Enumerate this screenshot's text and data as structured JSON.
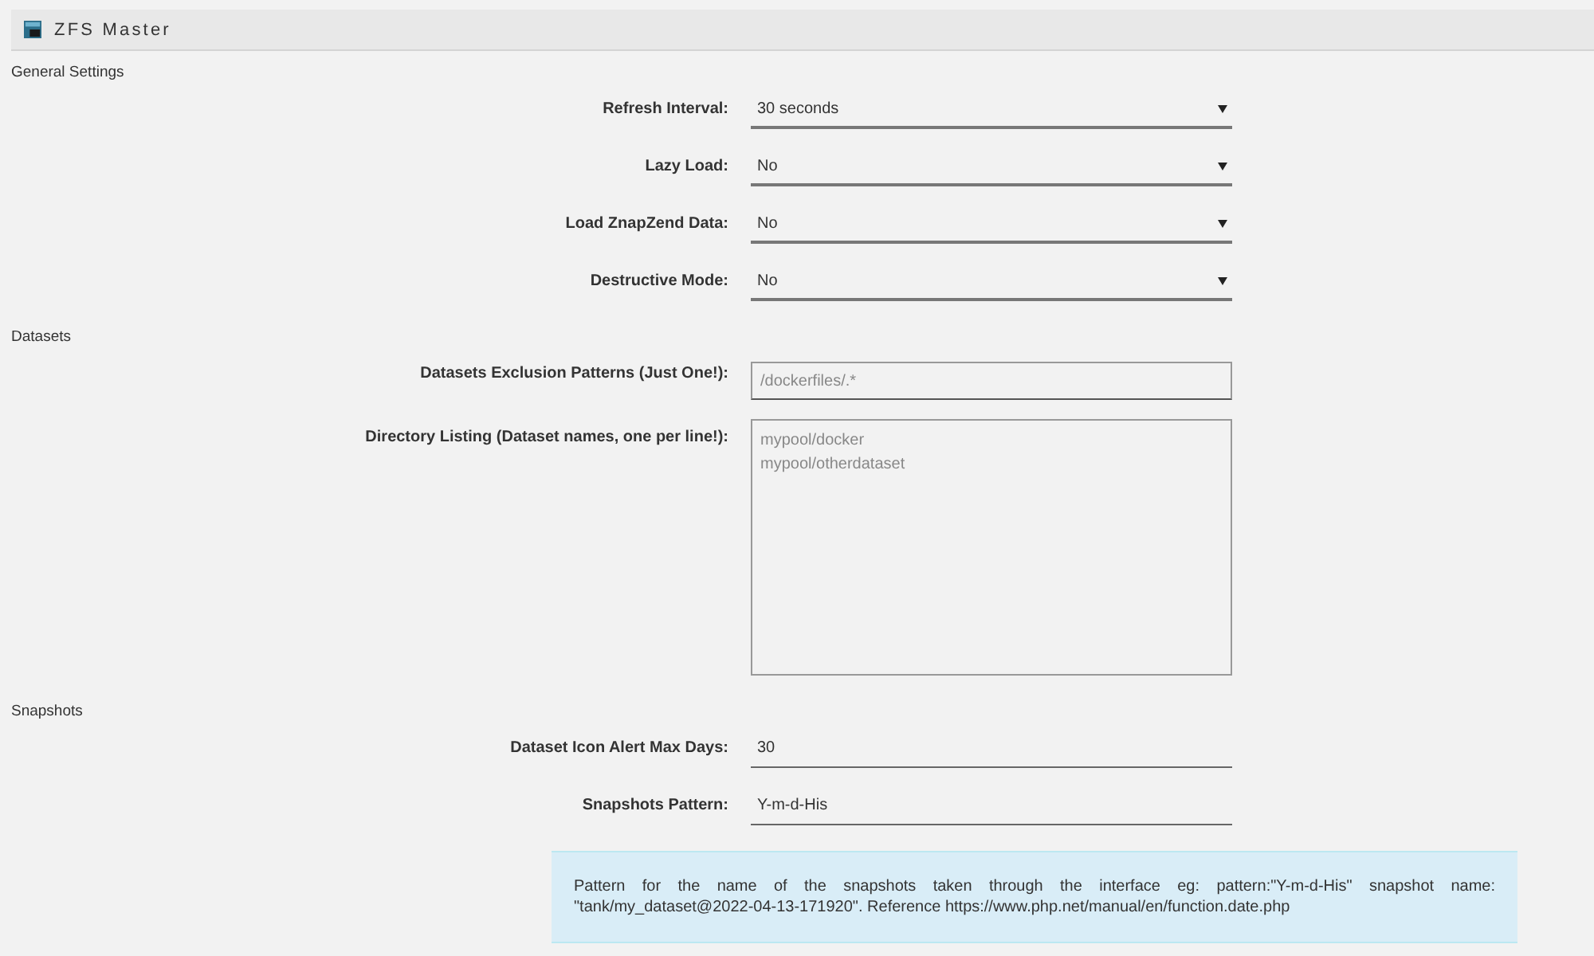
{
  "header": {
    "title": "ZFS Master"
  },
  "sections": [
    {
      "title": "General Settings",
      "fields": [
        {
          "kind": "select",
          "label": "Refresh Interval:",
          "value": "30 seconds"
        },
        {
          "kind": "select",
          "label": "Lazy Load:",
          "value": "No"
        },
        {
          "kind": "select",
          "label": "Load ZnapZend Data:",
          "value": "No"
        },
        {
          "kind": "select",
          "label": "Destructive Mode:",
          "value": "No"
        }
      ]
    },
    {
      "title": "Datasets",
      "fields": [
        {
          "kind": "text",
          "label": "Datasets Exclusion Patterns (Just One!):",
          "placeholder": "/dockerfiles/.*"
        },
        {
          "kind": "textarea",
          "label": "Directory Listing (Dataset names, one per line!):",
          "placeholder": "mypool/docker\nmypool/otherdataset"
        }
      ]
    },
    {
      "title": "Snapshots",
      "fields": [
        {
          "kind": "line",
          "label": "Dataset Icon Alert Max Days:",
          "value": "30"
        },
        {
          "kind": "line",
          "label": "Snapshots Pattern:",
          "value": "Y-m-d-His"
        }
      ],
      "note": "Pattern for the name of the snapshots taken through the interface eg: pattern:\"Y-m-d-His\" snapshot name: \"tank/my_dataset@2022-04-13-171920\". Reference https://www.php.net/manual/en/function.date.php"
    }
  ]
}
